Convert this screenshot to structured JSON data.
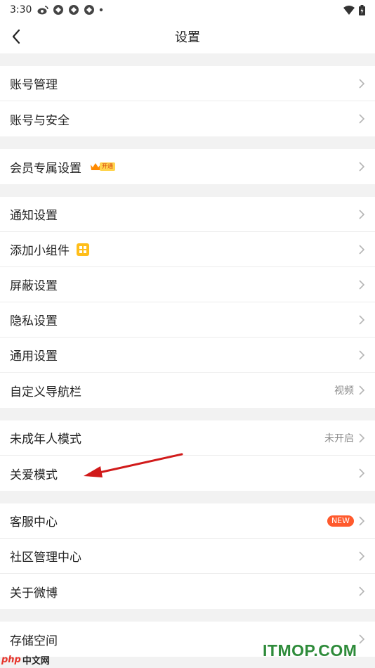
{
  "status": {
    "time": "3:30"
  },
  "header": {
    "title": "设置"
  },
  "groups": [
    [
      {
        "label": "账号管理"
      },
      {
        "label": "账号与安全"
      }
    ],
    [
      {
        "label": "会员专属设置",
        "badge": "开通"
      }
    ],
    [
      {
        "label": "通知设置"
      },
      {
        "label": "添加小组件"
      },
      {
        "label": "屏蔽设置"
      },
      {
        "label": "隐私设置"
      },
      {
        "label": "通用设置"
      },
      {
        "label": "自定义导航栏",
        "value": "视频"
      }
    ],
    [
      {
        "label": "未成年人模式",
        "value": "未开启"
      },
      {
        "label": "关爱模式"
      }
    ],
    [
      {
        "label": "客服中心",
        "badge": "NEW"
      },
      {
        "label": "社区管理中心"
      },
      {
        "label": "关于微博"
      }
    ],
    [
      {
        "label": "存储空间"
      }
    ]
  ],
  "watermark": {
    "php": "php",
    "cn": "中文网",
    "site": "ITMOP.COM"
  },
  "colors": {
    "new_badge": "#ff5a2d",
    "vip_pill": "#ffd44d",
    "annotation_arrow": "#d11a1a",
    "watermark_green": "#2e8b3a"
  }
}
